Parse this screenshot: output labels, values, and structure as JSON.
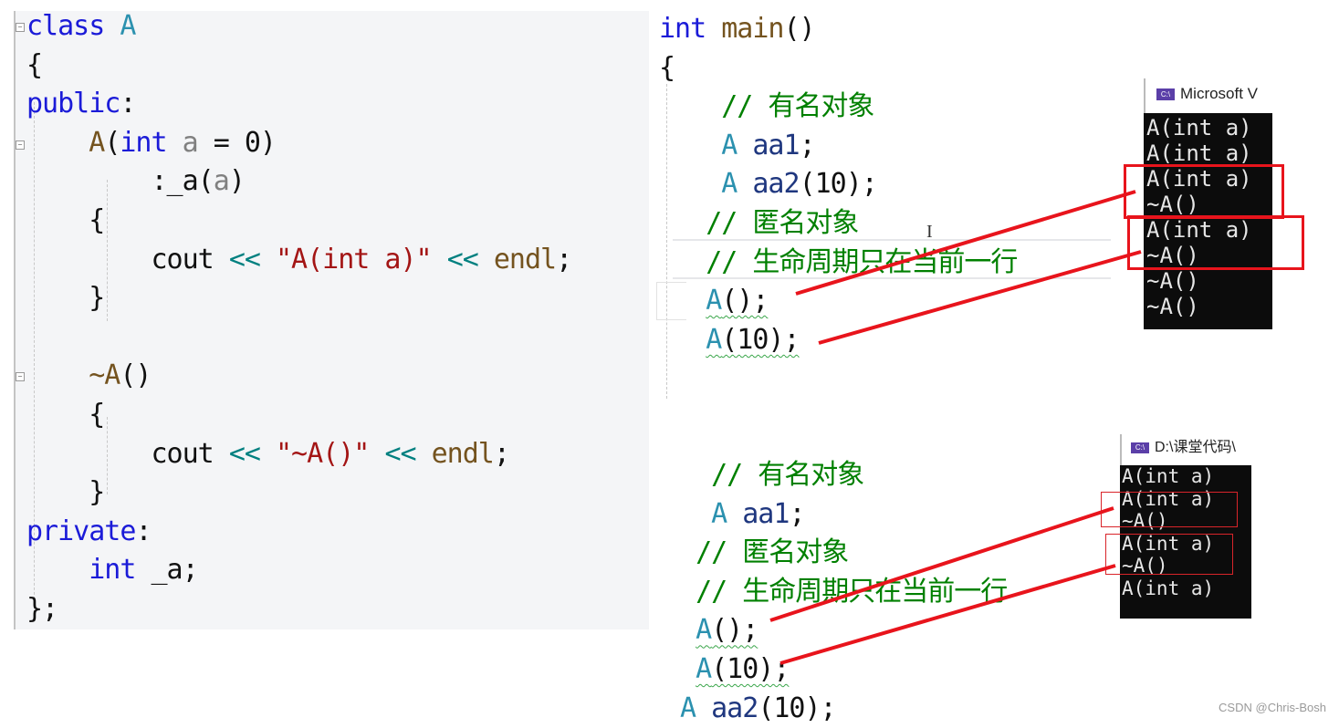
{
  "class_code": {
    "lines": [
      [
        {
          "t": "class",
          "c": "kw"
        },
        {
          "t": " "
        },
        {
          "t": "A",
          "c": "cls"
        }
      ],
      [
        {
          "t": "{"
        }
      ],
      [
        {
          "t": "public",
          "c": "kw"
        },
        {
          "t": ":"
        }
      ],
      [
        {
          "t": "    "
        },
        {
          "t": "A",
          "c": "fn"
        },
        {
          "t": "("
        },
        {
          "t": "int",
          "c": "kw"
        },
        {
          "t": " "
        },
        {
          "t": "a",
          "c": "param"
        },
        {
          "t": " = 0)"
        }
      ],
      [
        {
          "t": "        :_a("
        },
        {
          "t": "a",
          "c": "param"
        },
        {
          "t": ")"
        }
      ],
      [
        {
          "t": "    {"
        }
      ],
      [
        {
          "t": "        cout "
        },
        {
          "t": "<<",
          "c": "op"
        },
        {
          "t": " "
        },
        {
          "t": "\"A(int a)\"",
          "c": "str"
        },
        {
          "t": " "
        },
        {
          "t": "<<",
          "c": "op"
        },
        {
          "t": " "
        },
        {
          "t": "endl",
          "c": "fn"
        },
        {
          "t": ";"
        }
      ],
      [
        {
          "t": "    }"
        }
      ],
      [
        {
          "t": ""
        }
      ],
      [
        {
          "t": "    "
        },
        {
          "t": "~A",
          "c": "fn"
        },
        {
          "t": "()"
        }
      ],
      [
        {
          "t": "    {"
        }
      ],
      [
        {
          "t": "        cout "
        },
        {
          "t": "<<",
          "c": "op"
        },
        {
          "t": " "
        },
        {
          "t": "\"~A()\"",
          "c": "str"
        },
        {
          "t": " "
        },
        {
          "t": "<<",
          "c": "op"
        },
        {
          "t": " "
        },
        {
          "t": "endl",
          "c": "fn"
        },
        {
          "t": ";"
        }
      ],
      [
        {
          "t": "    }"
        }
      ],
      [
        {
          "t": "private",
          "c": "kw"
        },
        {
          "t": ":"
        }
      ],
      [
        {
          "t": "    "
        },
        {
          "t": "int",
          "c": "kw"
        },
        {
          "t": " _a;"
        }
      ],
      [
        {
          "t": "};"
        }
      ]
    ]
  },
  "main_code_top": {
    "lines": [
      [
        {
          "t": "int",
          "c": "kw"
        },
        {
          "t": " "
        },
        {
          "t": "main",
          "c": "fn"
        },
        {
          "t": "()"
        }
      ],
      [
        {
          "t": "{"
        }
      ],
      [
        {
          "t": "    "
        },
        {
          "t": "// 有名对象",
          "c": "cmt"
        }
      ],
      [
        {
          "t": "    "
        },
        {
          "t": "A",
          "c": "cls"
        },
        {
          "t": " "
        },
        {
          "t": "aa1",
          "c": "var"
        },
        {
          "t": ";"
        }
      ],
      [
        {
          "t": "    "
        },
        {
          "t": "A",
          "c": "cls"
        },
        {
          "t": " "
        },
        {
          "t": "aa2",
          "c": "var"
        },
        {
          "t": "(10);"
        }
      ],
      [
        {
          "t": "   "
        },
        {
          "t": "// 匿名对象",
          "c": "cmt"
        }
      ],
      [
        {
          "t": "   "
        },
        {
          "t": "// 生命周期只在当前一行",
          "c": "cmt"
        }
      ],
      [
        {
          "t": "   "
        },
        {
          "t": "A",
          "c": "cls",
          "sq": true
        },
        {
          "t": "();",
          "sq": true
        }
      ],
      [
        {
          "t": "   "
        },
        {
          "t": "A",
          "c": "cls",
          "sq": true
        },
        {
          "t": "(10);",
          "sq": true
        }
      ]
    ]
  },
  "main_code_bottom": {
    "lines": [
      [
        {
          "t": "  "
        },
        {
          "t": "// 有名对象",
          "c": "cmt"
        }
      ],
      [
        {
          "t": "  "
        },
        {
          "t": "A",
          "c": "cls"
        },
        {
          "t": " "
        },
        {
          "t": "aa1",
          "c": "var"
        },
        {
          "t": ";"
        }
      ],
      [
        {
          "t": " "
        },
        {
          "t": "// 匿名对象",
          "c": "cmt"
        }
      ],
      [
        {
          "t": " "
        },
        {
          "t": "// 生命周期只在当前一行",
          "c": "cmt"
        }
      ],
      [
        {
          "t": " "
        },
        {
          "t": "A",
          "c": "cls",
          "sq": true
        },
        {
          "t": "();",
          "sq": true
        }
      ],
      [
        {
          "t": " "
        },
        {
          "t": "A",
          "c": "cls",
          "sq": true
        },
        {
          "t": "(10);",
          "sq": true
        }
      ],
      [
        {
          "t": "A",
          "c": "cls"
        },
        {
          "t": " "
        },
        {
          "t": "aa2",
          "c": "var"
        },
        {
          "t": "(10);"
        }
      ]
    ]
  },
  "console_top": {
    "title": "Microsoft V",
    "icon": "C:\\",
    "output": [
      "A(int a)",
      "A(int a)",
      "A(int a)",
      "~A()",
      "A(int a)",
      "~A()",
      "~A()",
      "~A()"
    ]
  },
  "console_bottom": {
    "title": "D:\\课堂代码\\",
    "icon": "C:\\",
    "output": [
      "A(int a)",
      "A(int a)",
      "~A()",
      "A(int a)",
      "~A()",
      "A(int a)"
    ]
  },
  "watermark": "CSDN @Chris-Bosh",
  "colors": {
    "annotation_red": "#e8141c",
    "editor_bg": "#f4f5f7",
    "console_bg": "#0c0c0c"
  }
}
